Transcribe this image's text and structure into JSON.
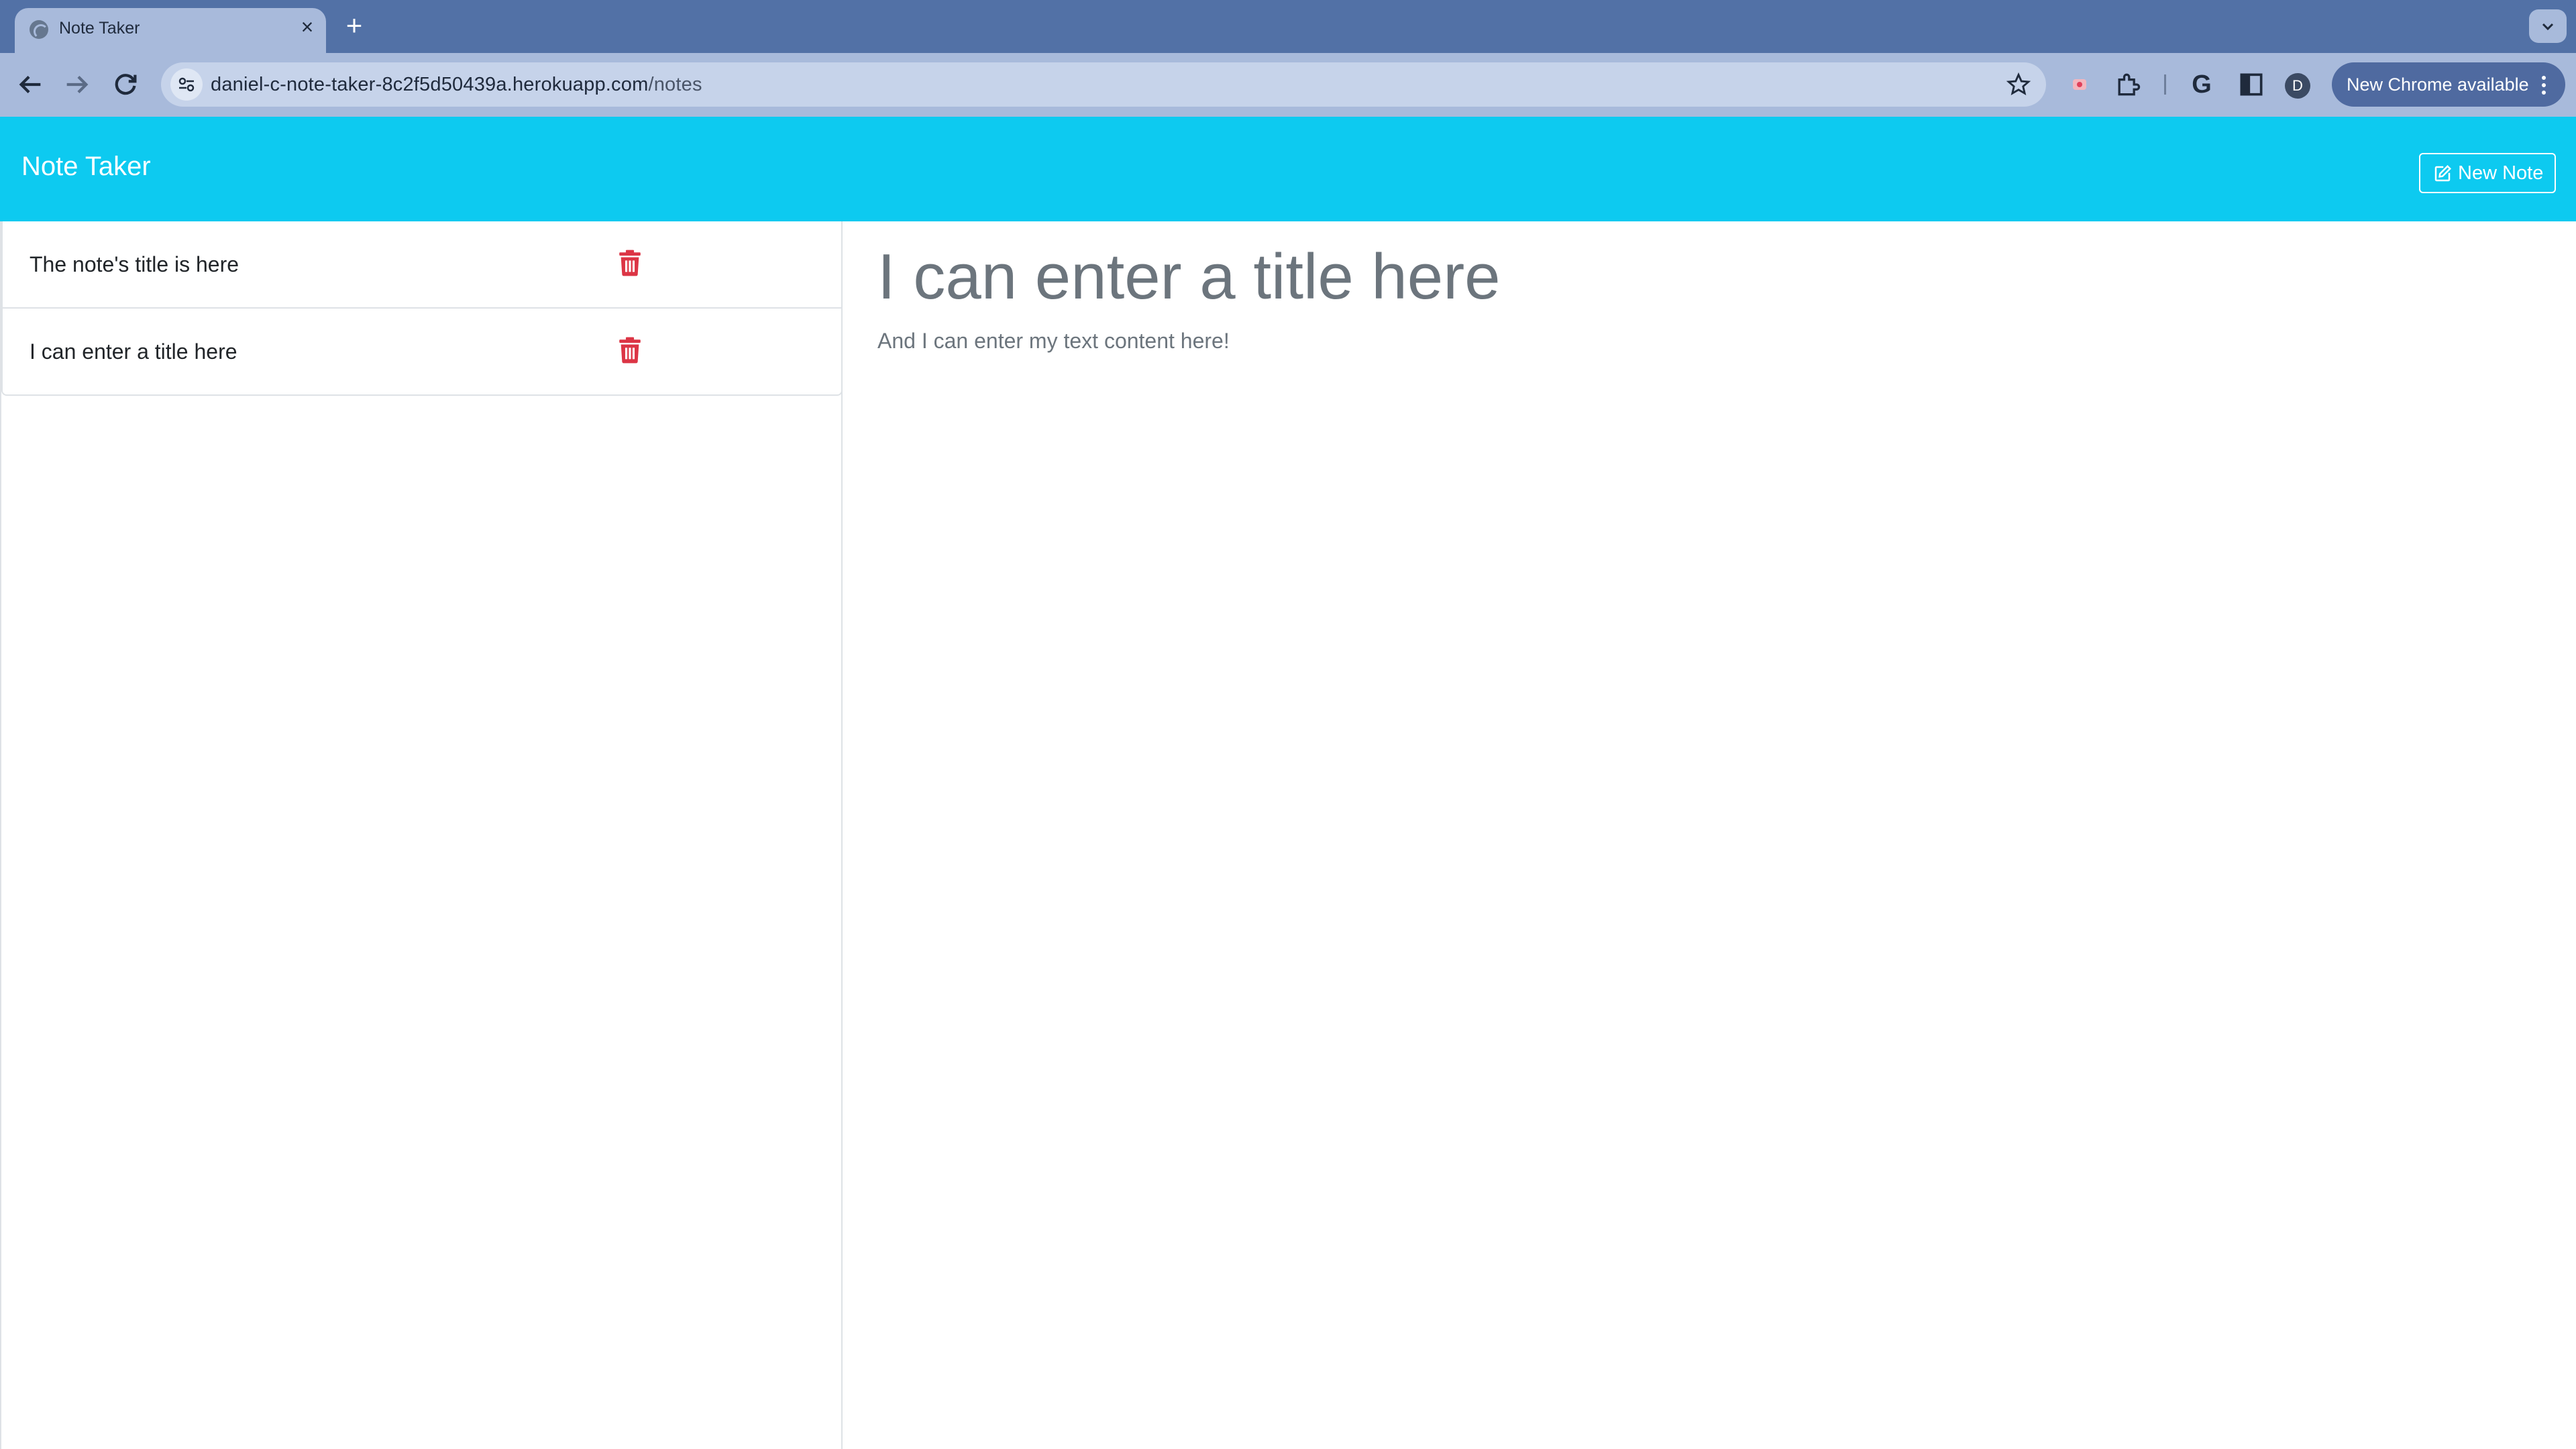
{
  "browser": {
    "tab_title": "Note Taker",
    "tab_close": "×",
    "new_tab": "+",
    "url_host": "daniel-c-note-taker-8c2f5d50439a.herokuapp.com",
    "url_path": "/notes",
    "profile_initial": "D",
    "update_label": "New Chrome available"
  },
  "app": {
    "brand": "Note Taker",
    "new_note_label": "New Note",
    "notes": [
      {
        "title": "The note's title is here"
      },
      {
        "title": "I can enter a title here"
      }
    ],
    "active_note": {
      "title": "I can enter a title here",
      "text": "And I can enter my text content here!"
    }
  },
  "colors": {
    "header_bg": "#0dcaf0",
    "delete_icon": "#dc3545",
    "tabstrip_bg": "#5271a6",
    "toolbar_bg": "#a8badb"
  }
}
